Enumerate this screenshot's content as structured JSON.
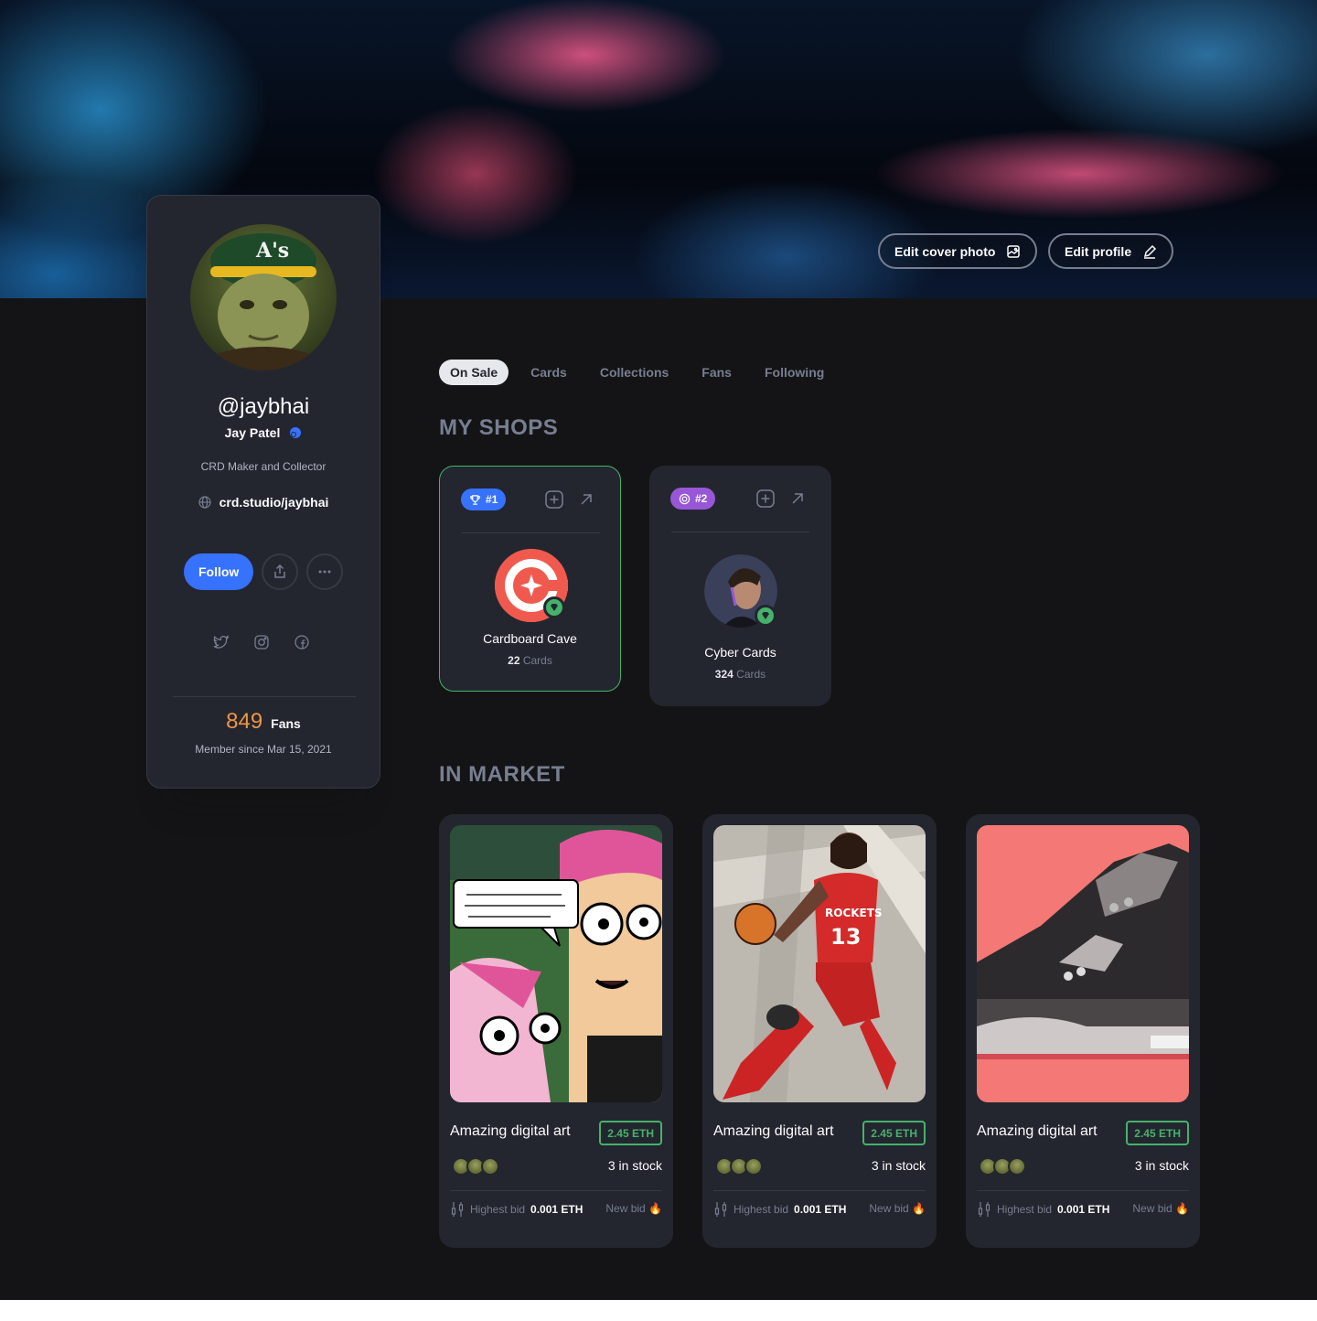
{
  "cover": {
    "edit_cover_label": "Edit cover photo",
    "edit_profile_label": "Edit profile"
  },
  "profile": {
    "handle": "@jaybhai",
    "name": "Jay Patel",
    "bio": "CRD Maker and Collector",
    "website": "crd.studio/jaybhai",
    "follow_label": "Follow",
    "fans_count": "849",
    "fans_label": "Fans",
    "member_since": "Member since Mar 15, 2021"
  },
  "tabs": [
    {
      "label": "On Sale",
      "active": true
    },
    {
      "label": "Cards",
      "active": false
    },
    {
      "label": "Collections",
      "active": false
    },
    {
      "label": "Fans",
      "active": false
    },
    {
      "label": "Following",
      "active": false
    }
  ],
  "sections": {
    "shops_title": "MY SHOPS",
    "market_title": "IN MARKET"
  },
  "shops": [
    {
      "rank": "#1",
      "name": "Cardboard Cave",
      "count": "22",
      "count_label": "Cards",
      "rank_color": "#3772ff"
    },
    {
      "rank": "#2",
      "name": "Cyber Cards",
      "count": "324",
      "count_label": "Cards",
      "rank_color": "#9757d7"
    }
  ],
  "market": [
    {
      "title": "Amazing digital art",
      "price": "2.45 ETH",
      "stock": "3 in stock",
      "bid_label": "Highest bid",
      "bid_value": "0.001 ETH",
      "new_bid": "New bid 🔥"
    },
    {
      "title": "Amazing digital art",
      "price": "2.45 ETH",
      "stock": "3 in stock",
      "bid_label": "Highest bid",
      "bid_value": "0.001 ETH",
      "new_bid": "New bid 🔥"
    },
    {
      "title": "Amazing digital art",
      "price": "2.45 ETH",
      "stock": "3 in stock",
      "bid_label": "Highest bid",
      "bid_value": "0.001 ETH",
      "new_bid": "New bid 🔥"
    }
  ],
  "colors": {
    "accent": "#3772ff",
    "success": "#45b26b",
    "fans": "#ef9543",
    "background": "#141416",
    "card": "#23262f"
  }
}
